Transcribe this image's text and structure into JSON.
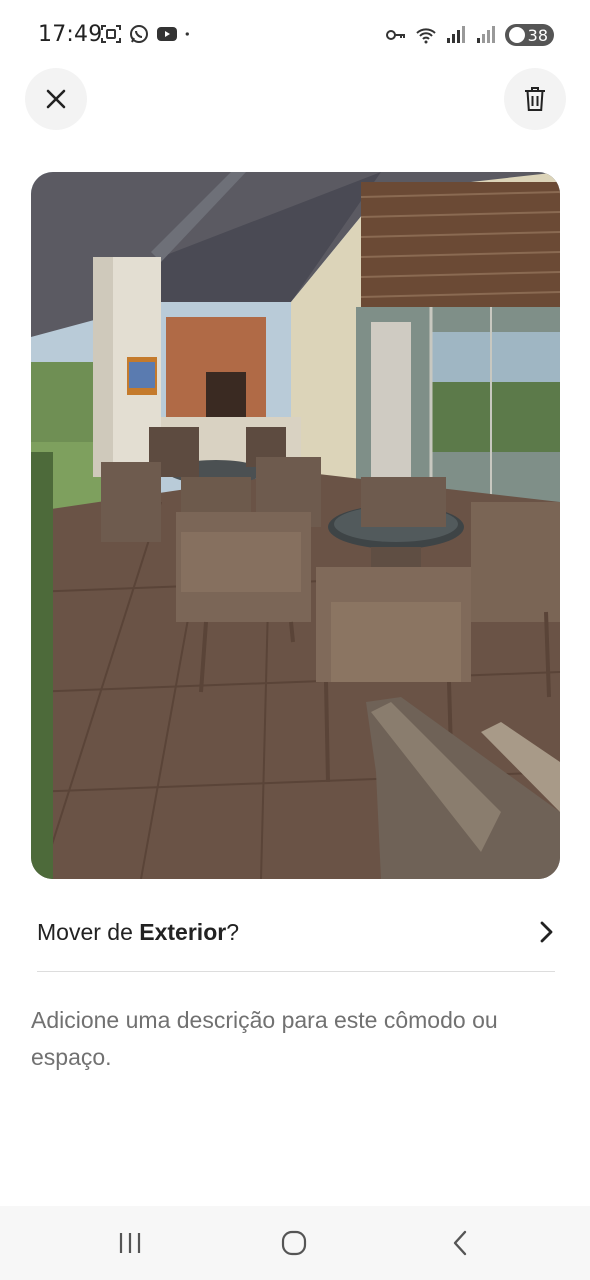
{
  "status_bar": {
    "time": "17:49",
    "battery_level": "38",
    "left_icons": [
      "screenshot-icon",
      "whatsapp-icon",
      "youtube-icon",
      "notification-dot-icon"
    ],
    "right_icons": [
      "vpn-key-icon",
      "wifi-icon",
      "signal-icon",
      "signal-icon-2",
      "battery-icon"
    ]
  },
  "header": {
    "close_icon": "close-icon",
    "delete_icon": "trash-icon"
  },
  "photo": {
    "subject": "outdoor covered terrace"
  },
  "move_row": {
    "prefix": "Mover de ",
    "room": "Exterior",
    "suffix": "?",
    "chevron_icon": "chevron-right-icon"
  },
  "description": {
    "placeholder": "Adicione uma descrição para este cômodo ou espaço."
  },
  "nav_bar": {
    "recents_icon": "recents-icon",
    "home_icon": "home-icon",
    "back_icon": "back-icon"
  }
}
